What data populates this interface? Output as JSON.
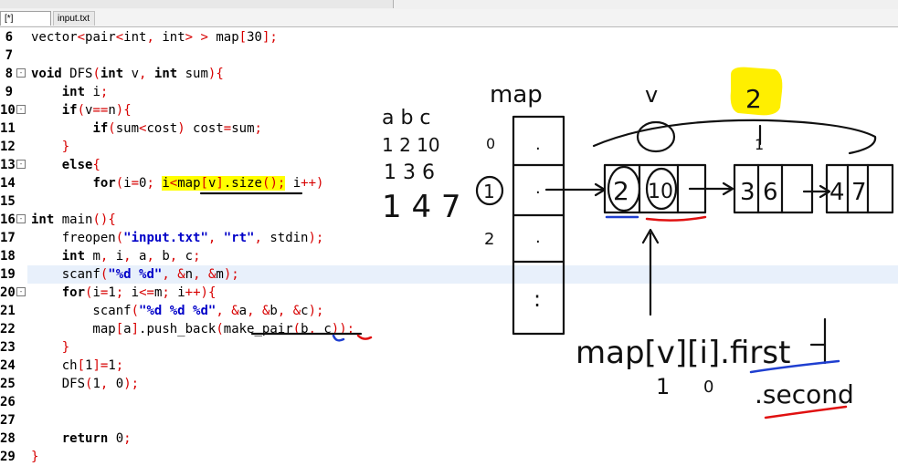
{
  "tabs": [
    {
      "label": "[*] main.cpp",
      "active": true
    },
    {
      "label": "input.txt",
      "active": false
    }
  ],
  "code": [
    {
      "n": "6",
      "parts": [
        [
          "t",
          "vector<pair<int, int> > map[30];"
        ]
      ]
    },
    {
      "n": "7",
      "parts": []
    },
    {
      "n": "8",
      "fold": "-",
      "parts": [
        [
          "k",
          "void"
        ],
        [
          "t",
          " DFS("
        ],
        [
          "k",
          "int"
        ],
        [
          "t",
          " v, "
        ],
        [
          "k",
          "int"
        ],
        [
          "t",
          " sum){"
        ]
      ]
    },
    {
      "n": "9",
      "parts": [
        [
          "t",
          "    "
        ],
        [
          "k",
          "int"
        ],
        [
          "t",
          " i;"
        ]
      ]
    },
    {
      "n": "10",
      "fold": "-",
      "parts": [
        [
          "t",
          "    "
        ],
        [
          "k",
          "if"
        ],
        [
          "t",
          "(v==n){"
        ]
      ]
    },
    {
      "n": "11",
      "parts": [
        [
          "t",
          "        "
        ],
        [
          "k",
          "if"
        ],
        [
          "t",
          "(sum<cost) cost=sum;"
        ]
      ]
    },
    {
      "n": "12",
      "parts": [
        [
          "t",
          "    }"
        ]
      ]
    },
    {
      "n": "13",
      "fold": "-",
      "parts": [
        [
          "t",
          "    "
        ],
        [
          "k",
          "else"
        ],
        [
          "t",
          "{"
        ]
      ]
    },
    {
      "n": "14",
      "parts": [
        [
          "t",
          "        "
        ],
        [
          "k",
          "for"
        ],
        [
          "t",
          "(i=0; "
        ],
        [
          "h",
          "i<map[v].size();"
        ],
        [
          "t",
          " i++)"
        ]
      ]
    },
    {
      "n": "15",
      "parts": []
    },
    {
      "n": "16",
      "fold": "-",
      "parts": [
        [
          "k",
          "int"
        ],
        [
          "t",
          " main(){"
        ]
      ]
    },
    {
      "n": "17",
      "parts": [
        [
          "t",
          "    freopen("
        ],
        [
          "s",
          "\"input.txt\""
        ],
        [
          "t",
          ", "
        ],
        [
          "s",
          "\"rt\""
        ],
        [
          "t",
          ", stdin);"
        ]
      ]
    },
    {
      "n": "18",
      "parts": [
        [
          "t",
          "    "
        ],
        [
          "k",
          "int"
        ],
        [
          "t",
          " m, i, a, b, c;"
        ]
      ]
    },
    {
      "n": "19",
      "parts": [
        [
          "t",
          "    scanf("
        ],
        [
          "s",
          "\"%d %d\""
        ],
        [
          "t",
          ", &n, &m);"
        ]
      ]
    },
    {
      "n": "20",
      "fold": "-",
      "parts": [
        [
          "t",
          "    "
        ],
        [
          "k",
          "for"
        ],
        [
          "t",
          "(i=1; i<=m; i++){"
        ]
      ]
    },
    {
      "n": "21",
      "parts": [
        [
          "t",
          "        scanf("
        ],
        [
          "s",
          "\"%d %d %d\""
        ],
        [
          "t",
          ", &a, &b, &c);"
        ]
      ]
    },
    {
      "n": "22",
      "parts": [
        [
          "t",
          "        map[a].push_back(make_pair(b, c));"
        ]
      ]
    },
    {
      "n": "23",
      "parts": [
        [
          "t",
          "    }"
        ]
      ]
    },
    {
      "n": "24",
      "parts": [
        [
          "t",
          "    ch[1]=1;"
        ]
      ]
    },
    {
      "n": "25",
      "parts": [
        [
          "t",
          "    DFS(1, 0);"
        ]
      ]
    },
    {
      "n": "26",
      "parts": []
    },
    {
      "n": "27",
      "parts": []
    },
    {
      "n": "28",
      "parts": [
        [
          "t",
          "    "
        ],
        [
          "k",
          "return"
        ],
        [
          "t",
          " 0;"
        ]
      ]
    },
    {
      "n": "29",
      "parts": [
        [
          "t",
          "}"
        ]
      ]
    }
  ],
  "annotations": {
    "map_label": "map",
    "abc_header": "a b c",
    "abc_rows": [
      "1 2 10",
      "1 3 6",
      "1 4 7"
    ],
    "index_labels": [
      "0",
      "1",
      "2"
    ],
    "cell_dot": ".",
    "cell_vdots": ":",
    "v_label": "v",
    "size_label": "2",
    "count_label": "1",
    "node1": [
      "2",
      "10"
    ],
    "node2": [
      "3",
      "6"
    ],
    "node3": [
      "4",
      "7"
    ],
    "expr": "map[v][i].first",
    "expr_second": ".second",
    "under_v": "1",
    "under_i": "0",
    "colors": {
      "highlight": "#ffff00",
      "blue_ink": "#1f3fd0",
      "red_ink": "#e01010",
      "ink": "#111111"
    }
  }
}
